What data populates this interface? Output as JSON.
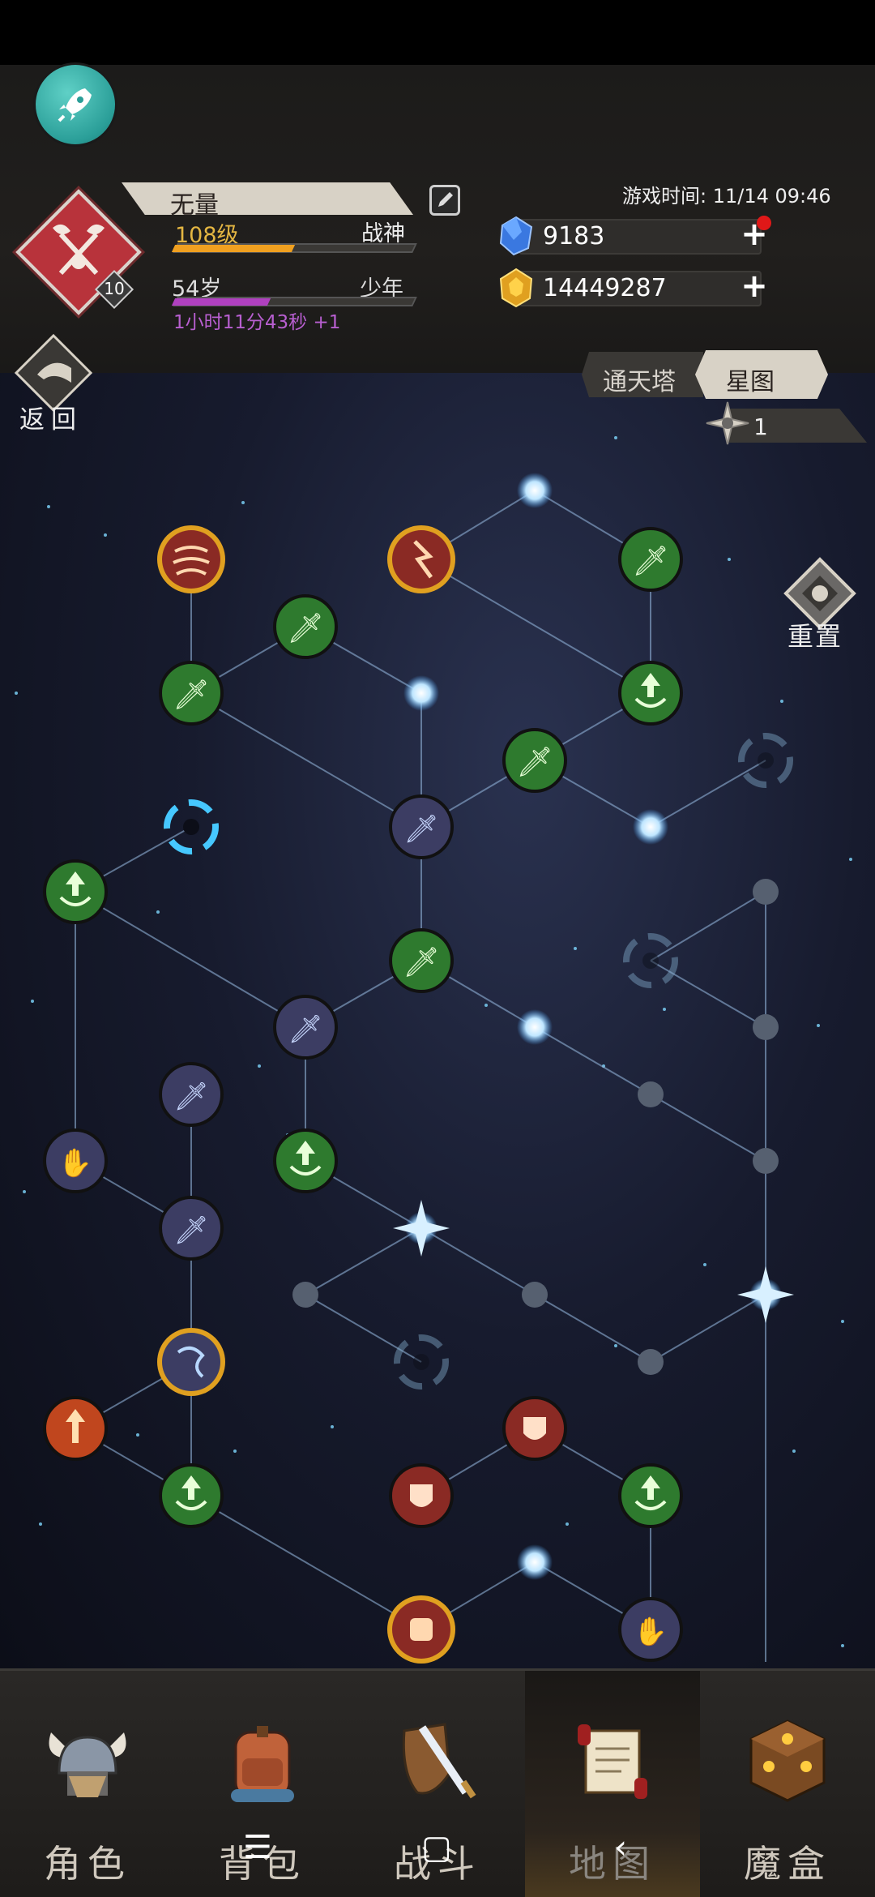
{
  "header": {
    "player_name": "无量",
    "level": "108级",
    "title": "战神",
    "age": "54岁",
    "life_stage": "少年",
    "timer": "1小时11分43秒 +1",
    "game_time_label": "游戏时间: 11/14 09:46",
    "avatar_level": "10",
    "level_progress": 0.5,
    "age_progress": 0.4
  },
  "resources": {
    "diamonds": "9183",
    "gold": "14449287"
  },
  "nav": {
    "back_label": "返回",
    "tab_tower": "通天塔",
    "tab_starmap": "星图",
    "star_points": "1",
    "reset_label": "重置"
  },
  "bottom_nav": {
    "items": [
      {
        "label": "角色",
        "icon": "viking-helmet-icon"
      },
      {
        "label": "背包",
        "icon": "backpack-icon"
      },
      {
        "label": "战斗",
        "icon": "sword-shield-icon"
      },
      {
        "label": "地图",
        "icon": "scroll-map-icon",
        "active": true
      },
      {
        "label": "魔盒",
        "icon": "magic-cube-icon"
      }
    ]
  },
  "colors": {
    "accent_gold": "#e4b642",
    "xp_bar": "#f0a020",
    "age_bar": "#b040c0",
    "node_green": "#2e7a2e",
    "node_purple": "#3c3d63",
    "node_red": "#8a2a24",
    "glow": "#9fd8ff"
  }
}
